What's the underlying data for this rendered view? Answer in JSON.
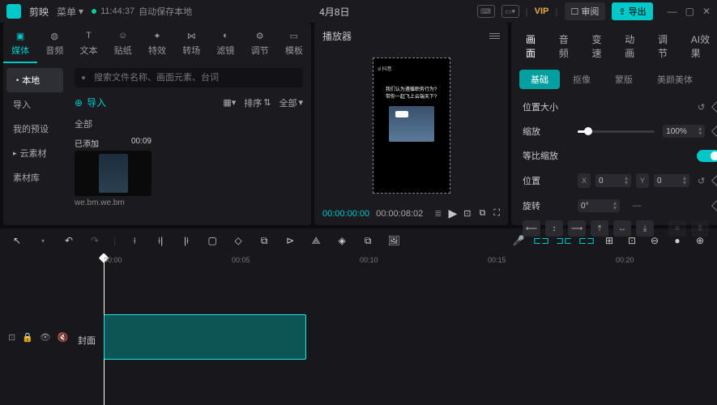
{
  "app": {
    "name": "剪映"
  },
  "titlebar": {
    "menu": "菜单",
    "autosave_time": "11:44:37",
    "autosave_text": "自动保存本地",
    "project_name": "4月8日",
    "vip": "VIP",
    "review": "审阅",
    "export": "导出"
  },
  "top_tabs": [
    {
      "label": "媒体",
      "icon": "media"
    },
    {
      "label": "音频",
      "icon": "audio"
    },
    {
      "label": "文本",
      "icon": "text"
    },
    {
      "label": "贴纸",
      "icon": "sticker"
    },
    {
      "label": "特效",
      "icon": "effect"
    },
    {
      "label": "转场",
      "icon": "transition"
    },
    {
      "label": "滤镜",
      "icon": "filter"
    },
    {
      "label": "调节",
      "icon": "adjust"
    },
    {
      "label": "模板",
      "icon": "template"
    }
  ],
  "sidebar": {
    "items": [
      "本地",
      "导入",
      "我的预设",
      "云素材",
      "素材库"
    ]
  },
  "media": {
    "search_placeholder": "搜索文件名称、画面元素、台词",
    "import": "导入",
    "sort": "排序",
    "all": "全部",
    "category": "全部",
    "clip": {
      "badge": "已添加",
      "duration": "00:09",
      "filename": "we.bm.we.bm"
    }
  },
  "player": {
    "title": "播放器",
    "current": "00:00:00:00",
    "total": "00:00:08:02",
    "caption_line1": "我们认为遵循职务行为?",
    "caption_line2": "带你一起飞上云端天下?"
  },
  "inspector": {
    "tabs": [
      "画面",
      "音频",
      "变速",
      "动画",
      "调节",
      "AI效果"
    ],
    "subtabs": [
      "基础",
      "抠像",
      "蒙版",
      "美颜美体"
    ],
    "section": "位置大小",
    "scale_label": "缩放",
    "scale_value": "100%",
    "ratio_label": "等比缩放",
    "position_label": "位置",
    "x_label": "X",
    "x_value": "0",
    "y_label": "Y",
    "y_value": "0",
    "rotate_label": "旋转",
    "rotate_value": "0°"
  },
  "timeline": {
    "ticks": [
      "00:00",
      "00:05",
      "00:10",
      "00:15",
      "00:20"
    ],
    "cover": "封面"
  }
}
